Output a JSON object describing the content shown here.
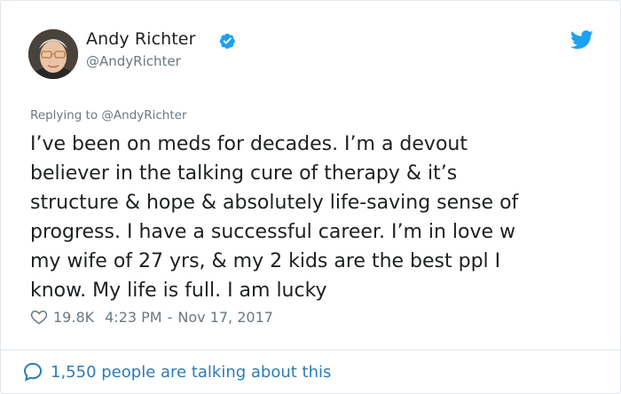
{
  "author": {
    "display_name": "Andy Richter",
    "handle": "@AndyRichter",
    "verified": true
  },
  "replying_to": "Replying to @AndyRichter",
  "tweet": {
    "lines": [
      "I’ve been on meds for decades. I’m a devout",
      "believer in the talking cure of therapy & it’s",
      "structure & hope & absolutely life-saving sense of",
      "progress. I have a successful career. I’m in love w",
      "my wife of 27 yrs, & my 2 kids are the best ppl I",
      "know. My life is full. I am lucky"
    ]
  },
  "meta": {
    "likes": "19.8K",
    "time": "4:23 PM",
    "separator": "-",
    "date": "Nov 17, 2017"
  },
  "footer": {
    "talking_text": "1,550 people are talking about this"
  },
  "colors": {
    "twitter_blue": "#1da1f2",
    "link_blue": "#2b7bb9",
    "secondary_text": "#697882",
    "border": "#e1e8ed"
  },
  "icons": {
    "verified": "verified-badge-icon",
    "brand": "twitter-bird-icon",
    "like": "heart-icon",
    "conversation": "speech-bubble-icon"
  }
}
